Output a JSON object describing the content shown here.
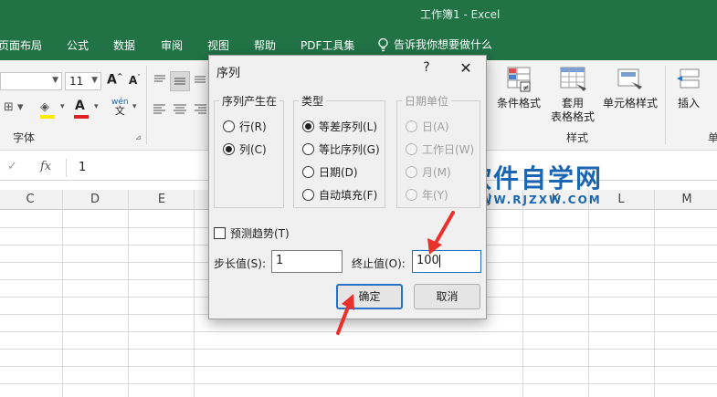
{
  "titlebar": {
    "doc_title": "工作簿1  -  Excel"
  },
  "menu": {
    "tabs": [
      "页面布局",
      "公式",
      "数据",
      "审阅",
      "视图",
      "帮助",
      "PDF工具集"
    ],
    "tell_me": "告诉我你想要做什么"
  },
  "ribbon": {
    "font_size": "11",
    "font_group_label": "字体",
    "styles_group_label": "样式",
    "conditional_format": "条件格式",
    "table_format_line1": "套用",
    "table_format_line2": "表格格式",
    "cell_styles": "单元格样式",
    "insert": "插入",
    "wen": "wén",
    "wen_sub": "文",
    "partial_right": "单"
  },
  "formula_bar": {
    "fx": "fx",
    "value": "1"
  },
  "columns": [
    "C",
    "D",
    "E",
    "J",
    "K",
    "L",
    "M"
  ],
  "watermark": {
    "cn": "软件自学网",
    "en": "WWW.RJZXW.COM"
  },
  "dialog": {
    "title": "序列",
    "help": "?",
    "close": "✕",
    "series_in": {
      "legend": "序列产生在",
      "options": [
        {
          "label": "行(R)",
          "checked": false
        },
        {
          "label": "列(C)",
          "checked": true
        }
      ]
    },
    "type": {
      "legend": "类型",
      "options": [
        {
          "label": "等差序列(L)",
          "checked": true
        },
        {
          "label": "等比序列(G)",
          "checked": false
        },
        {
          "label": "日期(D)",
          "checked": false
        },
        {
          "label": "自动填充(F)",
          "checked": false
        }
      ]
    },
    "date_unit": {
      "legend": "日期单位",
      "options": [
        {
          "label": "日(A)",
          "checked": true
        },
        {
          "label": "工作日(W)",
          "checked": false
        },
        {
          "label": "月(M)",
          "checked": false
        },
        {
          "label": "年(Y)",
          "checked": false
        }
      ]
    },
    "trend_label": "预测趋势(T)",
    "step_label": "步长值(S):",
    "step_value": "1",
    "stop_label": "终止值(O):",
    "stop_value": "100",
    "ok": "确定",
    "cancel": "取消"
  },
  "colors": {
    "excel_green": "#217346",
    "annotation_red": "#e8312b",
    "watermark_blue": "#1a66b3"
  }
}
